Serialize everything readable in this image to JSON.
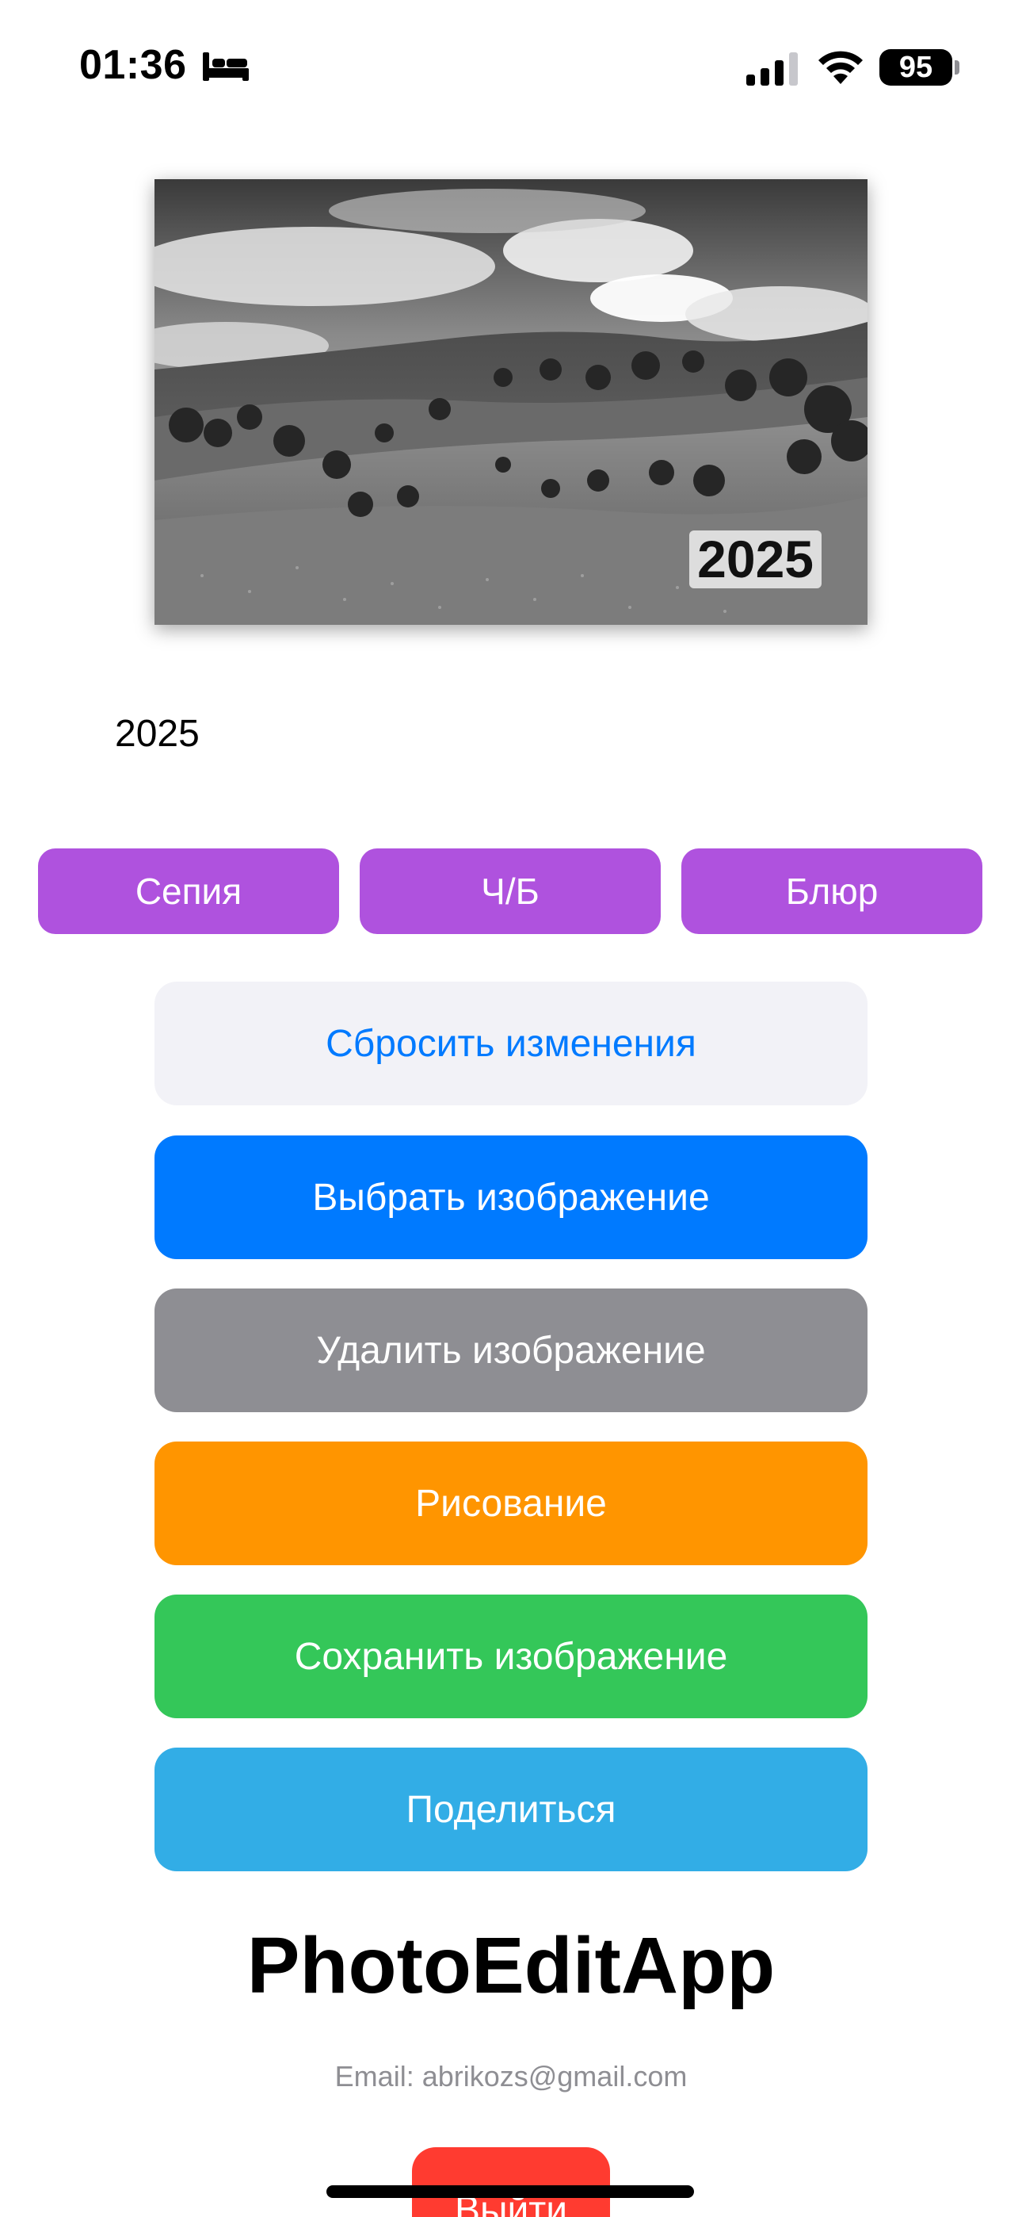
{
  "status_bar": {
    "time": "01:36",
    "battery": "95",
    "icons": [
      "bed-icon",
      "cellular-signal-icon",
      "wifi-icon",
      "battery-icon"
    ]
  },
  "photo": {
    "badge_text": "2025",
    "description_icon": "landscape-photo"
  },
  "caption": "2025",
  "filters": {
    "sepia": "Сепия",
    "bw": "Ч/Б",
    "blur": "Блюр",
    "color": "#af52de"
  },
  "actions": {
    "reset": "Сбросить изменения",
    "choose": "Выбрать изображение",
    "delete": "Удалить изображение",
    "draw": "Рисование",
    "save": "Сохранить изображение",
    "share": "Поделиться"
  },
  "colors": {
    "reset_bg": "#f2f2f7",
    "reset_text": "#007aff",
    "choose": "#007aff",
    "delete": "#8e8e93",
    "draw": "#ff9500",
    "save": "#34c759",
    "share": "#32ade6",
    "logout": "#ff3b30"
  },
  "app_title": "PhotoEditApp",
  "email": "Email: abrikozs@gmail.com",
  "logout": "Выйти"
}
